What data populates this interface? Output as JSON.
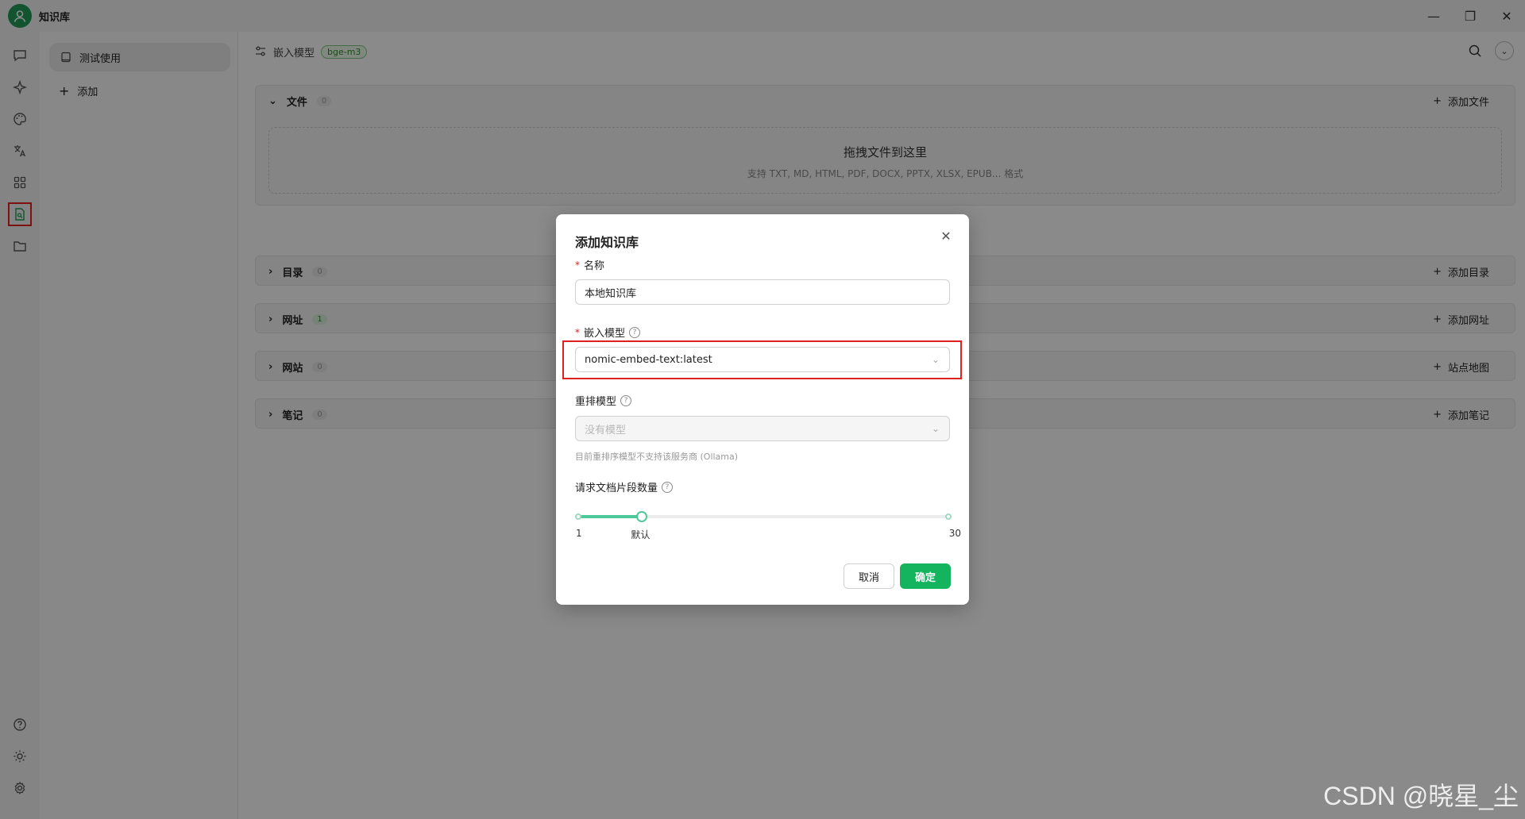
{
  "app": {
    "title": "知识库"
  },
  "kb_list": {
    "items": [
      {
        "label": "测试使用"
      }
    ],
    "add_label": "添加"
  },
  "header": {
    "embed_label": "嵌入模型",
    "embed_tag": "bge-m3"
  },
  "sections": [
    {
      "title": "文件",
      "count": "0",
      "action": "添加文件"
    },
    {
      "title": "目录",
      "count": "0",
      "action": "添加目录"
    },
    {
      "title": "网址",
      "count": "1",
      "action": "添加网址"
    },
    {
      "title": "网站",
      "count": "0",
      "action": "站点地图"
    },
    {
      "title": "笔记",
      "count": "0",
      "action": "添加笔记"
    }
  ],
  "dropzone": {
    "title": "拖拽文件到这里",
    "formats": "支持 TXT, MD, HTML, PDF, DOCX, PPTX, XLSX, EPUB... 格式"
  },
  "dialog": {
    "title": "添加知识库",
    "name_label": "名称",
    "name_value": "本地知识库",
    "embed_label": "嵌入模型",
    "embed_value": "nomic-embed-text:latest",
    "rerank_label": "重排模型",
    "rerank_placeholder": "没有模型",
    "rerank_hint": "目前重排序模型不支持该服务商 (Ollama)",
    "docs_label": "请求文档片段数量",
    "slider": {
      "min_label": "1",
      "default_label": "默认",
      "max_label": "30",
      "min": 1,
      "max": 30,
      "value": 6
    },
    "cancel_label": "取消",
    "ok_label": "确定"
  },
  "watermark": "CSDN @晓星_尘",
  "colors": {
    "accent": "#14b35d",
    "highlight": "#e02020"
  },
  "icons": [
    "chat-icon",
    "sparkle-icon",
    "palette-icon",
    "translate-icon",
    "apps-icon",
    "knowledge-icon",
    "folder-icon",
    "help-icon",
    "theme-icon",
    "settings-icon"
  ]
}
